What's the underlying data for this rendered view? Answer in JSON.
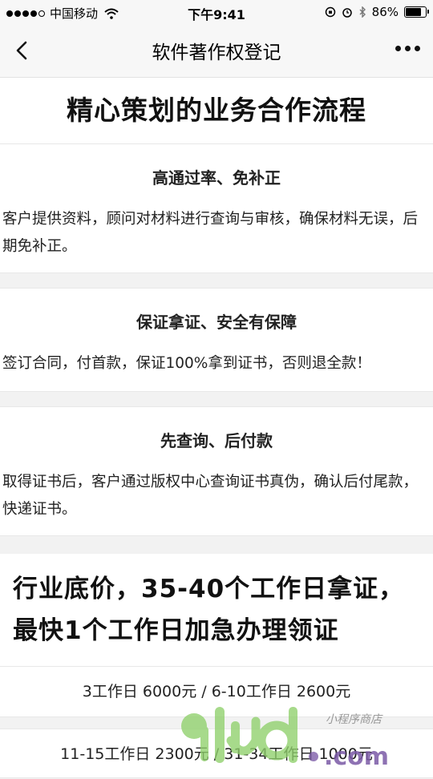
{
  "status_bar": {
    "carrier": "中国移动",
    "time": "下午9:41",
    "battery_percent": "86%",
    "battery_level": 0.86,
    "signal_bars_filled": 4,
    "signal_bars_total": 5
  },
  "nav": {
    "title": "软件著作权登记",
    "back_icon": "chevron-left-icon",
    "more_icon": "more-dots-icon"
  },
  "section": {
    "heading": "精心策划的业务合作流程",
    "cards": [
      {
        "title": "高通过率、免补正",
        "text": "客户提供资料，顾问对材料进行查询与审核，确保材料无误，后期免补正。"
      },
      {
        "title": "保证拿证、安全有保障",
        "text": "签订合同，付首款，保证100%拿到证书，否则退全款！"
      },
      {
        "title": "先查询、后付款",
        "text": "取得证书后，客户通过版权中心查询证书真伪，确认后付尾款，快递证书。"
      }
    ]
  },
  "pricing": {
    "heading": "行业底价，35-40个工作日拿证，最快1个工作日加急办理领证",
    "rows": [
      "3工作日 6000元 / 6-10工作日 2600元",
      "11-15工作日 2300元 / 31-34工作日 1000元"
    ]
  },
  "watermark": {
    "brand": "91ud.com",
    "tagline": "小程序商店"
  },
  "colors": {
    "background": "#f2f2f2",
    "card": "#ffffff",
    "text": "#111111",
    "watermark_green": "#8fd06b",
    "watermark_purple": "#7b5aa6"
  }
}
